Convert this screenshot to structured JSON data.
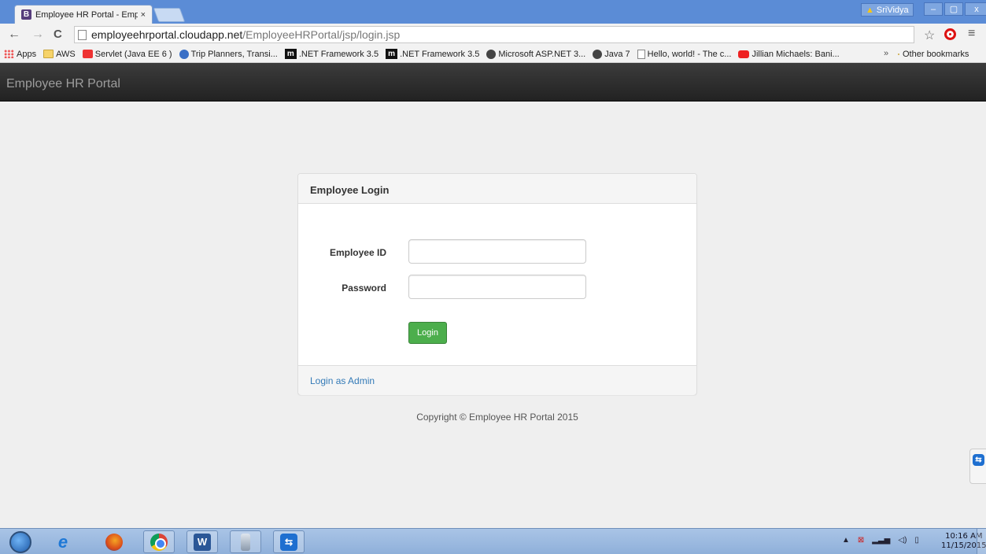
{
  "browser": {
    "tab_title": "Employee HR Portal - Emp",
    "tab_close": "×",
    "user_name": "SriVidya",
    "win_min": "–",
    "win_max": "▢",
    "win_close": "x",
    "url_host": "employeehrportal.cloudapp.net",
    "url_path": "/EmployeeHRPortal/jsp/login.jsp",
    "back": "←",
    "forward": "→",
    "reload": "C",
    "star": "☆",
    "menu": "≡",
    "bookmarks": [
      {
        "label": "Apps",
        "icon": "apps-icon"
      },
      {
        "label": "AWS",
        "icon": "folder-icon"
      },
      {
        "label": "Servlet (Java EE 6 )",
        "icon": "oracle-icon"
      },
      {
        "label": "Trip Planners, Transi...",
        "icon": "globe-icon"
      },
      {
        "label": ".NET Framework 3.5",
        "icon": "m-icon"
      },
      {
        "label": ".NET Framework 3.5",
        "icon": "m-icon"
      },
      {
        "label": "Microsoft ASP.NET 3...",
        "icon": "page-icon"
      },
      {
        "label": "Java 7",
        "icon": "page-icon"
      },
      {
        "label": "Hello, world! - The c...",
        "icon": "doc-icon"
      },
      {
        "label": "Jillian Michaels: Bani...",
        "icon": "youtube-icon"
      }
    ],
    "bookmarks_more": "»",
    "other_bookmarks": "Other bookmarks"
  },
  "app": {
    "brand": "Employee HR Portal",
    "panel_title": "Employee Login",
    "employee_id_label": "Employee ID",
    "password_label": "Password",
    "employee_id_value": "",
    "password_value": "",
    "login_button": "Login",
    "admin_link": "Login as Admin",
    "copyright": "Copyright © Employee HR Portal 2015"
  },
  "taskbar": {
    "time": "10:16 AM",
    "date": "11/15/2015",
    "word_letter": "W"
  }
}
